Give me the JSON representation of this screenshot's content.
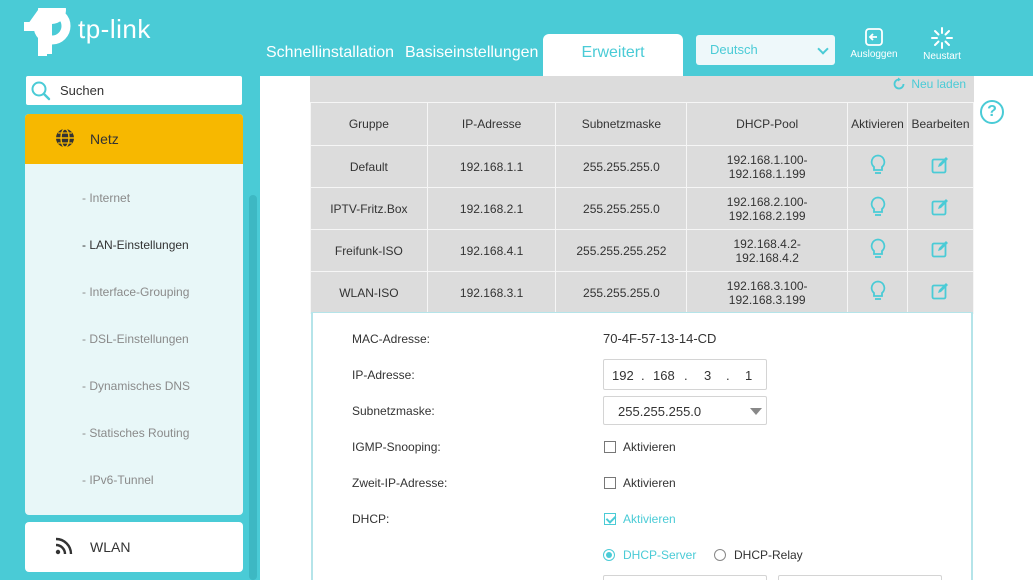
{
  "header": {
    "logo_text": "tp-link",
    "tabs": [
      {
        "label": "Schnellinstallation"
      },
      {
        "label": "Basiseinstellungen"
      },
      {
        "label": "Erweitert"
      }
    ],
    "language": "Deutsch",
    "logout_label": "Ausloggen",
    "restart_label": "Neustart"
  },
  "sidebar": {
    "search_placeholder": "Suchen",
    "active_section": "Netz",
    "items": [
      {
        "label": "- Internet"
      },
      {
        "label": "- LAN-Einstellungen"
      },
      {
        "label": "- Interface-Grouping"
      },
      {
        "label": "- DSL-Einstellungen"
      },
      {
        "label": "- Dynamisches DNS"
      },
      {
        "label": "- Statisches Routing"
      },
      {
        "label": "- IPv6-Tunnel"
      }
    ],
    "next_section": "WLAN"
  },
  "main": {
    "reload_label": "Neu laden",
    "help_label": "?",
    "table": {
      "headers": [
        "Gruppe",
        "IP-Adresse",
        "Subnetzmaske",
        "DHCP-Pool",
        "Aktivieren",
        "Bearbeiten"
      ],
      "rows": [
        {
          "group": "Default",
          "ip": "192.168.1.1",
          "mask": "255.255.255.0",
          "pool_start": "192.168.1.100-",
          "pool_end": "192.168.1.199"
        },
        {
          "group": "IPTV-Fritz.Box",
          "ip": "192.168.2.1",
          "mask": "255.255.255.0",
          "pool_start": "192.168.2.100-",
          "pool_end": "192.168.2.199"
        },
        {
          "group": "Freifunk-ISO",
          "ip": "192.168.4.1",
          "mask": "255.255.255.252",
          "pool_start": "192.168.4.2-",
          "pool_end": "192.168.4.2"
        },
        {
          "group": "WLAN-ISO",
          "ip": "192.168.3.1",
          "mask": "255.255.255.0",
          "pool_start": "192.168.3.100-",
          "pool_end": "192.168.3.199"
        }
      ]
    },
    "detail": {
      "mac_label": "MAC-Adresse:",
      "mac_value": "70-4F-57-13-14-CD",
      "ip_label": "IP-Adresse:",
      "ip_segments": [
        "192",
        "168",
        "3",
        "1"
      ],
      "ip_dot": ".",
      "mask_label": "Subnetzmaske:",
      "mask_value": "255.255.255.0",
      "igmp_label": "IGMP-Snooping:",
      "igmp_check": "Aktivieren",
      "second_ip_label": "Zweit-IP-Adresse:",
      "second_ip_check": "Aktivieren",
      "dhcp_label": "DHCP:",
      "dhcp_check": "Aktivieren",
      "dhcp_server": "DHCP-Server",
      "dhcp_relay": "DHCP-Relay"
    }
  },
  "colors": {
    "accent": "#4acbd6",
    "active_nav": "#f7b800",
    "table_bg": "#dcdcdc"
  }
}
